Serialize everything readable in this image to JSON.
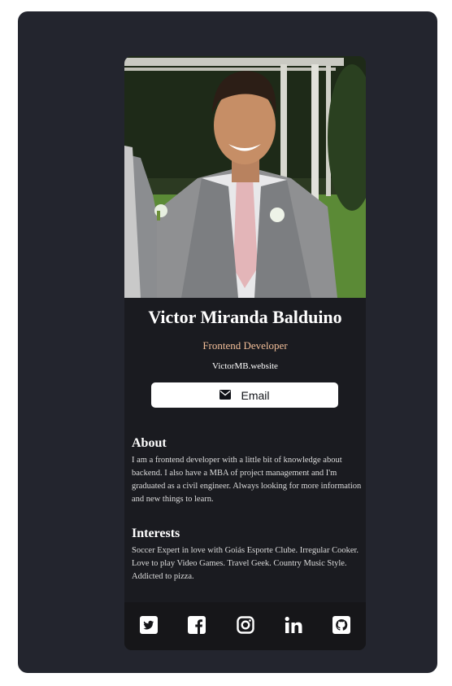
{
  "profile": {
    "name": "Victor Miranda Balduino",
    "role": "Frontend Developer",
    "website": "VictorMB.website",
    "email_label": "Email"
  },
  "about": {
    "title": "About",
    "text": "I am a frontend developer with a little bit of knowledge about backend. I also have a MBA of project management and I'm graduated as a civil engineer. Always looking for more information and new things to learn."
  },
  "interests": {
    "title": "Interests",
    "text": "Soccer Expert in love with Goiás Esporte Clube. Irregular Cooker. Love to play Video Games. Travel Geek. Country Music Style. Addicted to pizza."
  },
  "social": [
    {
      "name": "twitter-icon"
    },
    {
      "name": "facebook-icon"
    },
    {
      "name": "instagram-icon"
    },
    {
      "name": "linkedin-icon"
    },
    {
      "name": "github-icon"
    }
  ],
  "colors": {
    "page_bg": "#ffffff",
    "outer_bg": "#23252e",
    "card_bg": "#1a1b20",
    "footer_bg": "#161619",
    "role_accent": "#f3bf99"
  }
}
